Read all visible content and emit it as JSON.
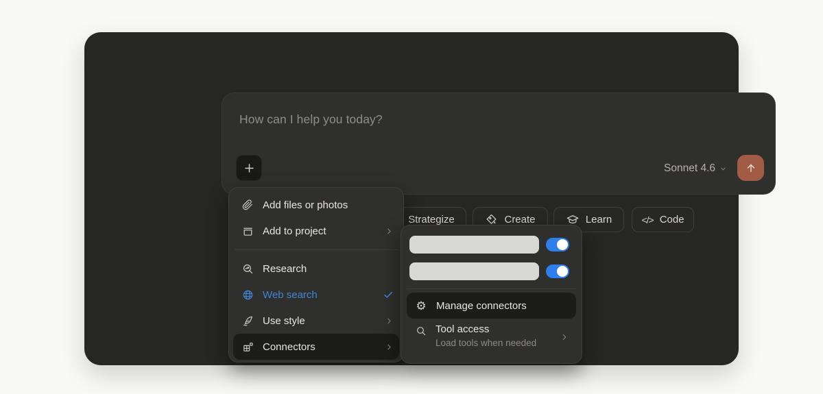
{
  "composer": {
    "placeholder": "How can I help you today?",
    "model": "Sonnet 4.6"
  },
  "chips": [
    {
      "label": "Strategize",
      "icon": "strategize-icon"
    },
    {
      "label": "Create",
      "icon": "create-icon"
    },
    {
      "label": "Learn",
      "icon": "learn-icon"
    },
    {
      "label": "Code",
      "icon": "code-icon",
      "glyph": "</>"
    }
  ],
  "menu": {
    "items": [
      {
        "label": "Add files or photos",
        "icon": "paperclip-icon"
      },
      {
        "label": "Add to project",
        "icon": "project-tray-icon",
        "has_submenu": true
      },
      {
        "label": "Research",
        "icon": "research-icon"
      },
      {
        "label": "Web search",
        "icon": "web-globe-icon",
        "selected": true
      },
      {
        "label": "Use style",
        "icon": "style-quill-icon",
        "has_submenu": true
      },
      {
        "label": "Connectors",
        "icon": "connectors-icon",
        "has_submenu": true,
        "highlighted": true
      }
    ]
  },
  "connectors_menu": {
    "connectors": [
      {
        "enabled": true
      },
      {
        "enabled": true
      }
    ],
    "manage_label": "Manage connectors",
    "gear_glyph": "⚙",
    "tool_access_title": "Tool access",
    "tool_access_subtitle": "Load tools when needed"
  },
  "colors": {
    "page_bg": "#f8f8f7",
    "card_bg": "#262624",
    "panel_bg": "#2f2f2d",
    "highlight_bg": "#1c1c1a",
    "accent_blue": "#4285d6",
    "toggle_blue": "#2e7fec",
    "send_button": "#a25c45",
    "redacted_bar": "#d8d8d6"
  }
}
